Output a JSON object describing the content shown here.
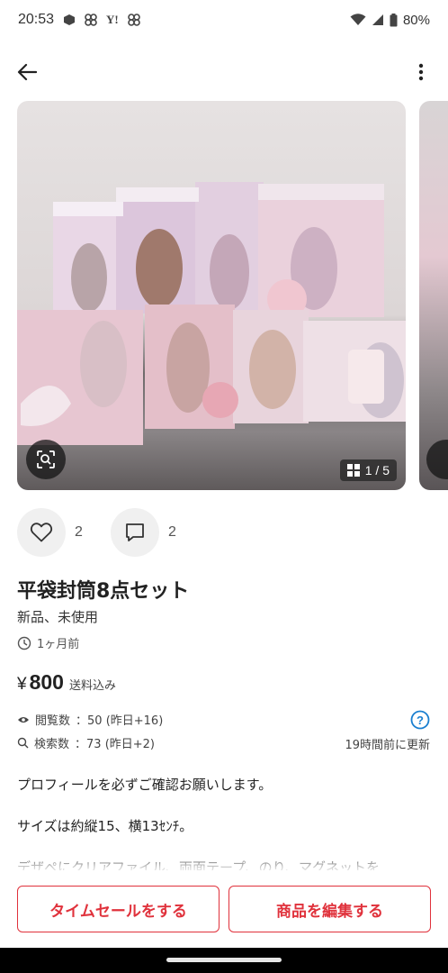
{
  "status_bar": {
    "time": "20:53",
    "notification_icons": [
      "app-icon",
      "pinwheel-icon",
      "yahoo-icon",
      "pinwheel-icon"
    ],
    "yahoo_text": "Y!",
    "battery": "80%"
  },
  "carousel": {
    "page_indicator": "1 / 5",
    "current_page": 1,
    "total_pages": 5
  },
  "actions": {
    "likes_count": "2",
    "comments_count": "2"
  },
  "item": {
    "title": "平袋封筒8点セット",
    "condition": "新品、未使用",
    "posted": "1ヶ月前",
    "currency": "¥",
    "price": "800",
    "shipping": "送料込み",
    "views_label": "閲覧数",
    "views": "：50 (昨日+16)",
    "searches_label": "検索数",
    "searches": "：73 (昨日+2)",
    "updated": "19時間前に更新"
  },
  "description": [
    "プロフィールを必ずご確認お願いします。",
    "サイズは約縦15、横13ｾﾝﾁ。",
    "デザペにクリアファイル、両面テープ、のり、マグネットを"
  ],
  "buttons": {
    "time_sale": "タイムセールをする",
    "edit_item": "商品を編集する"
  },
  "colors": {
    "accent": "#e0323c",
    "info_blue": "#1a7fd0"
  }
}
